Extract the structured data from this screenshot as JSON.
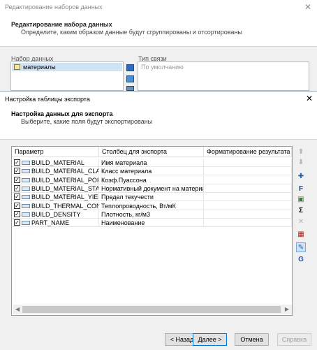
{
  "background_window": {
    "title": "Редактирование наборов данных",
    "header_title": "Редактирование набора данных",
    "header_subtitle": "Определите, каким образом данные будут сгруппированы и отсортированы",
    "dataset_label": "Набор данных",
    "dataset_item": "материалы",
    "link_type_label": "Тип связи",
    "link_type_placeholder": "По умолчанию",
    "close_glyph": "✕"
  },
  "dialog": {
    "title": "Настройка таблицы экспорта",
    "close_glyph": "✕",
    "header_title": "Настройка данных для экспорта",
    "header_subtitle": "Выберите, какие поля будут экспортированы",
    "columns": [
      "Параметр",
      "Столбец для экспорта",
      "Форматирование результата"
    ],
    "rows": [
      {
        "param": "BUILD_MATERIAL",
        "column": "Имя материала",
        "format": "",
        "checked": true
      },
      {
        "param": "BUILD_MATERIAL_CLASS",
        "column": "Класс материала",
        "format": "",
        "checked": true
      },
      {
        "param": "BUILD_MATERIAL_POIS...",
        "column": "Коэф.Пуассона",
        "format": "",
        "checked": true
      },
      {
        "param": "BUILD_MATERIAL_STAN...",
        "column": "Нормативный документ на материал",
        "format": "",
        "checked": true
      },
      {
        "param": "BUILD_MATERIAL_YIEL...",
        "column": "Предел текучести",
        "format": "",
        "checked": true
      },
      {
        "param": "BUILD_THERMAL_COND...",
        "column": "Теплопроводность, Вт/мК",
        "format": "",
        "checked": true
      },
      {
        "param": "BUILD_DENSITY",
        "column": "Плотность, кг/м3",
        "format": "",
        "checked": true
      },
      {
        "param": "PART_NAME",
        "column": "Наименование",
        "format": "",
        "checked": true
      }
    ],
    "check_glyph": "✓",
    "scroll_left": "◀",
    "scroll_right": "▶",
    "buttons": {
      "back": "< Назад",
      "next": "Далее >",
      "cancel": "Отмена",
      "help": "Справка"
    }
  },
  "side_tools": [
    {
      "icon": "move-up-icon",
      "glyph": "⬆",
      "color": "#b5b5b5"
    },
    {
      "icon": "move-down-icon",
      "glyph": "⬇",
      "color": "#b5b5b5"
    },
    {
      "icon": "add-parameter-icon",
      "glyph": "✚",
      "color": "#2a62a8"
    },
    {
      "icon": "format-icon",
      "glyph": "F",
      "color": "#1a3f6e"
    },
    {
      "icon": "image-icon",
      "glyph": "▣",
      "color": "#3b7a3b"
    },
    {
      "icon": "sum-icon",
      "glyph": "Σ",
      "color": "#000000"
    },
    {
      "icon": "remove-icon",
      "glyph": "✕",
      "color": "#b5b5b5"
    },
    {
      "icon": "table-delete-icon",
      "glyph": "▦",
      "color": "#b02020"
    },
    {
      "icon": "edit-icon",
      "glyph": "✎",
      "color": "#2a62a8"
    },
    {
      "icon": "formula-icon",
      "glyph": "G",
      "color": "#2a4fa8"
    }
  ]
}
